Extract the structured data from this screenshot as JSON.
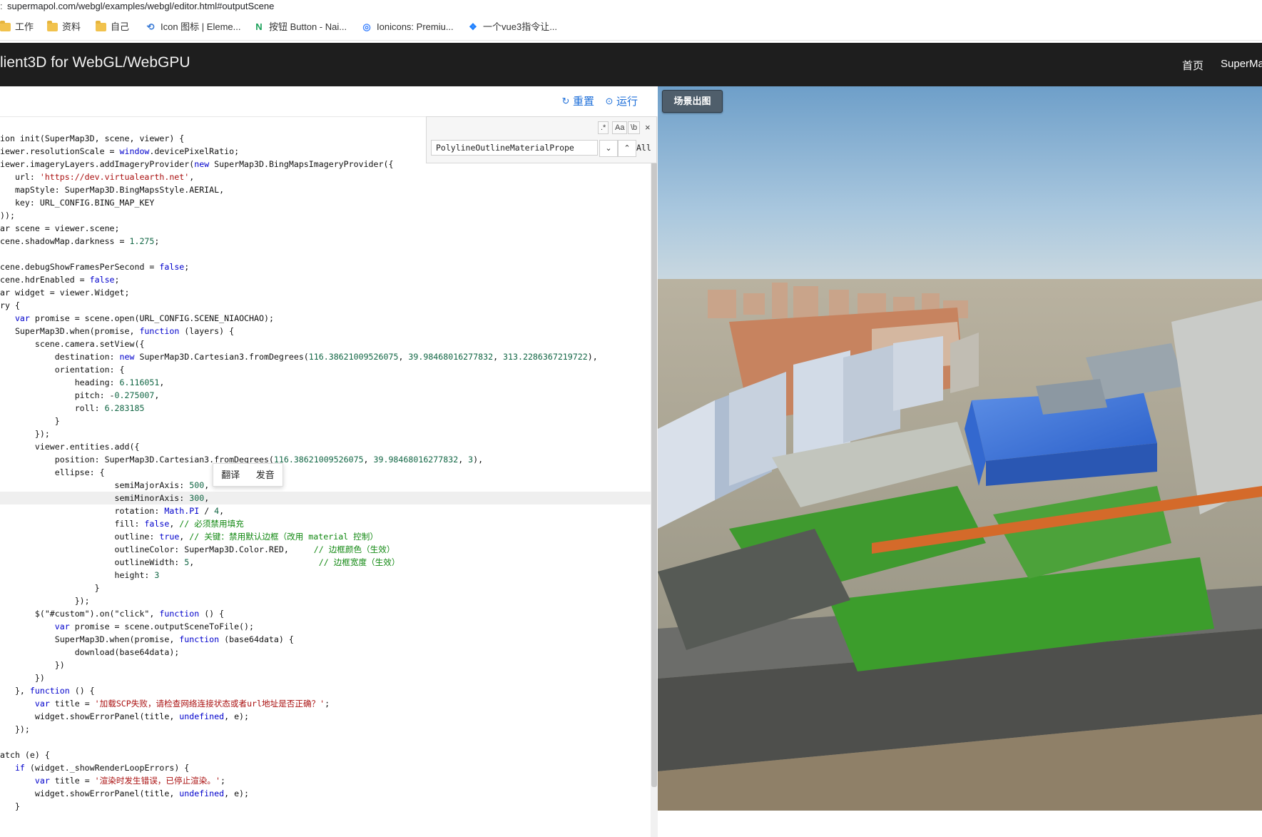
{
  "browser": {
    "url": "supermapol.com/webgl/examples/webgl/editor.html#outputScene",
    "bookmarks": [
      {
        "label": "工作",
        "icon": "folder-icon"
      },
      {
        "label": "资料",
        "icon": "folder-icon"
      },
      {
        "label": "自己",
        "icon": "folder-icon"
      },
      {
        "label": "Icon 图标 | Eleme...",
        "icon": "element-logo-icon"
      },
      {
        "label": "按钮 Button - Nai...",
        "icon": "naive-logo-icon"
      },
      {
        "label": "Ionicons: Premiu...",
        "icon": "ionicons-logo-icon"
      },
      {
        "label": "一个vue3指令让...",
        "icon": "juejin-logo-icon"
      }
    ]
  },
  "header": {
    "title": "lient3D for WebGL/WebGPU",
    "nav": [
      "首页",
      "SuperMa"
    ]
  },
  "toolbar": {
    "reset_label": "重置",
    "run_label": "运行"
  },
  "search": {
    "value": "PolylineOutlineMaterialPrope",
    "regex_label": ".*",
    "case_label": "Aa",
    "word_label": "\\b",
    "all_label": "All",
    "close_label": "×"
  },
  "popup": {
    "translate_label": "翻译",
    "pronounce_label": "发音"
  },
  "scene": {
    "output_button_label": "场景出图"
  },
  "code_lines": [
    "ion init(SuperMap3D, scene, viewer) {",
    "iewer.resolutionScale = window.devicePixelRatio;",
    "iewer.imageryLayers.addImageryProvider(new SuperMap3D.BingMapsImageryProvider({",
    "   url: 'https://dev.virtualearth.net',",
    "   mapStyle: SuperMap3D.BingMapsStyle.AERIAL,",
    "   key: URL_CONFIG.BING_MAP_KEY",
    "));",
    "ar scene = viewer.scene;",
    "cene.shadowMap.darkness = 1.275;",
    "",
    "cene.debugShowFramesPerSecond = false;",
    "cene.hdrEnabled = false;",
    "ar widget = viewer.Widget;",
    "ry {",
    "   var promise = scene.open(URL_CONFIG.SCENE_NIAOCHAO);",
    "   SuperMap3D.when(promise, function (layers) {",
    "       scene.camera.setView({",
    "           destination: new SuperMap3D.Cartesian3.fromDegrees(116.38621009526075, 39.98468016277832, 313.2286367219722),",
    "           orientation: {",
    "               heading: 6.116051,",
    "               pitch: -0.275007,",
    "               roll: 6.283185",
    "           }",
    "       });",
    "       viewer.entities.add({",
    "           position: SuperMap3D.Cartesian3.fromDegrees(116.38621009526075, 39.98468016277832, 3),",
    "           ellipse: {",
    "                       semiMajorAxis: 500,",
    "                       semiMinorAxis: 300,",
    "                       rotation: Math.PI / 4,",
    "                       fill: false, // 必须禁用填充",
    "                       outline: true, // 关键：禁用默认边框（改用 material 控制）",
    "                       outlineColor: SuperMap3D.Color.RED,     // 边框颜色（生效）",
    "                       outlineWidth: 5,                         // 边框宽度（生效）",
    "                       height: 3",
    "                   }",
    "               });",
    "       $(\"#custom\").on(\"click\", function () {",
    "           var promise = scene.outputSceneToFile();",
    "           SuperMap3D.when(promise, function (base64data) {",
    "               download(base64data);",
    "           })",
    "       })",
    "   }, function () {",
    "       var title = '加载SCP失败，请检查网络连接状态或者url地址是否正确？';",
    "       widget.showErrorPanel(title, undefined, e);",
    "   });",
    "",
    "atch (e) {",
    "   if (widget._showRenderLoopErrors) {",
    "       var title = '渲染时发生错误，已停止渲染。';",
    "       widget.showErrorPanel(title, undefined, e);",
    "   }"
  ],
  "colors": {
    "header_bg": "#1e1e1e",
    "link_blue": "#1e6fd9",
    "keyword": "#0000cc",
    "number": "#116644",
    "string": "#aa1111",
    "comment": "#118811",
    "scene_button_bg": "#4f5e6b"
  }
}
